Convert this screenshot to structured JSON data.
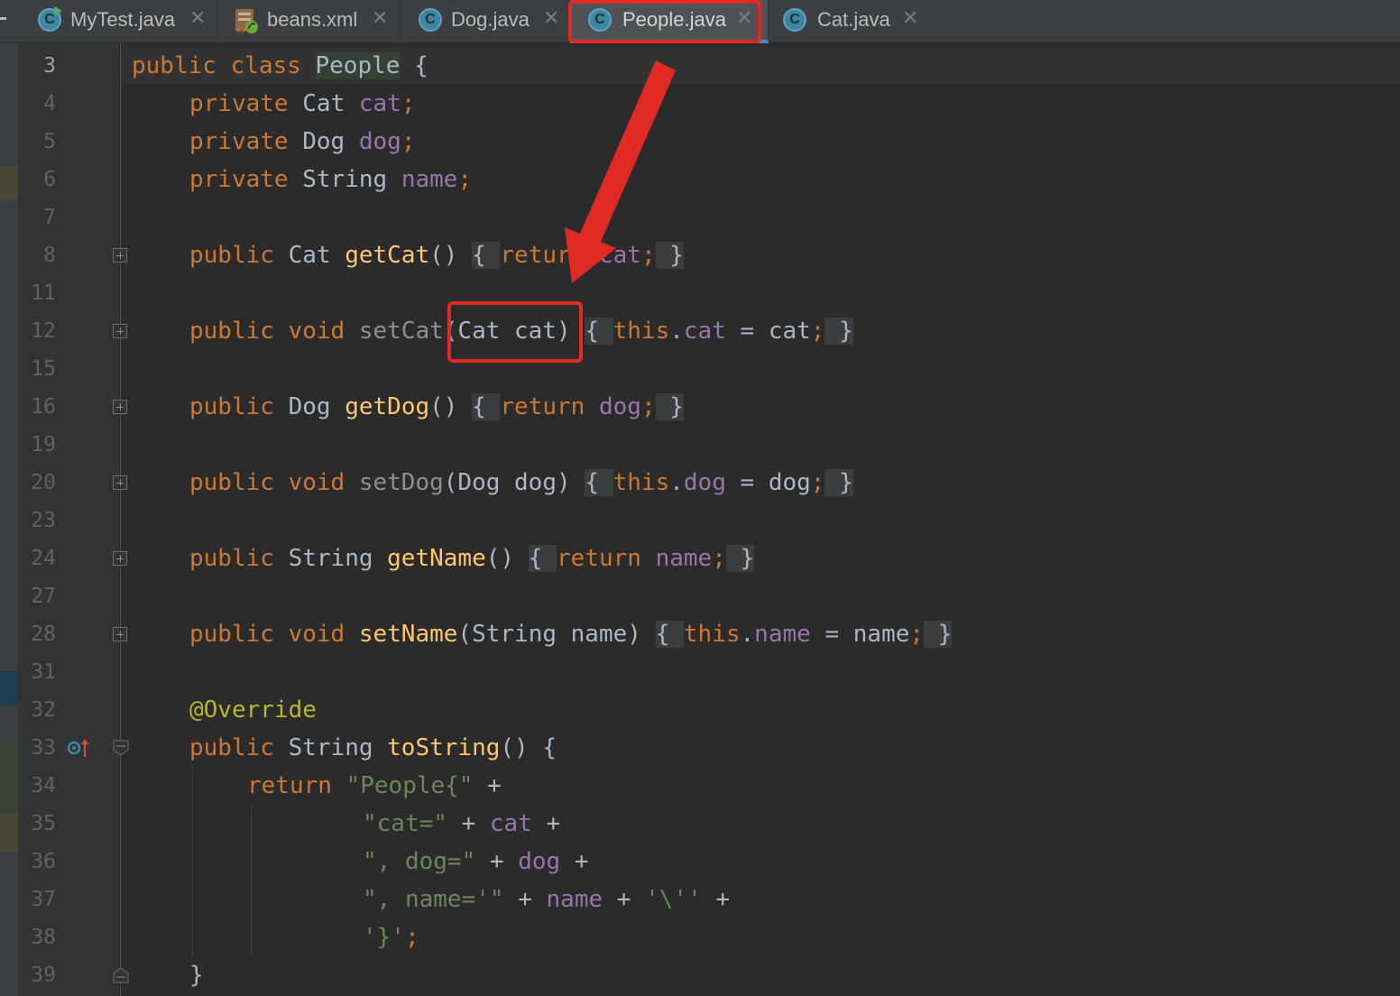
{
  "tabs": [
    {
      "label": "MyTest.java",
      "icon": "java-class-run-icon",
      "active": false
    },
    {
      "label": "beans.xml",
      "icon": "spring-xml-icon",
      "active": false
    },
    {
      "label": "Dog.java",
      "icon": "java-class-icon",
      "active": false
    },
    {
      "label": "People.java",
      "icon": "java-class-icon",
      "active": true
    },
    {
      "label": "Cat.java",
      "icon": "java-class-icon",
      "active": false
    }
  ],
  "tab_close_glyph": "✕",
  "class_icon_letter": "C",
  "line_numbers": [
    "3",
    "4",
    "5",
    "6",
    "7",
    "8",
    "11",
    "12",
    "15",
    "16",
    "19",
    "20",
    "23",
    "24",
    "27",
    "28",
    "31",
    "32",
    "33",
    "34",
    "35",
    "36",
    "37",
    "38",
    "39"
  ],
  "code": {
    "l3": {
      "kw": "public class ",
      "cls": "People",
      "rest": " {"
    },
    "l4": {
      "kw": "private ",
      "type": "Cat ",
      "field": "cat",
      "semi": ";"
    },
    "l5": {
      "kw": "private ",
      "type": "Dog ",
      "field": "dog",
      "semi": ";"
    },
    "l6": {
      "kw": "private ",
      "type": "String ",
      "field": "name",
      "semi": ";"
    },
    "l8": {
      "kw": "public ",
      "type": "Cat ",
      "fn": "getCat",
      "paren": "()",
      "sp": " ",
      "ob": "{ ",
      "ret": "return ",
      "field": "cat",
      "semi": ";",
      "sp2": " ",
      "cb": "}"
    },
    "l12": {
      "kw": "public void ",
      "fn": "setCat",
      "params": "(Cat cat)",
      "sp": " ",
      "ob": "{ ",
      "this": "this",
      "dot": ".",
      "field": "cat",
      "eq": " = cat",
      "semi": ";",
      "sp2": " ",
      "cb": "}"
    },
    "l16": {
      "kw": "public ",
      "type": "Dog ",
      "fn": "getDog",
      "paren": "()",
      "sp": " ",
      "ob": "{ ",
      "ret": "return ",
      "field": "dog",
      "semi": ";",
      "sp2": " ",
      "cb": "}"
    },
    "l20": {
      "kw": "public void ",
      "fn": "setDog",
      "params": "(Dog dog)",
      "sp": " ",
      "ob": "{ ",
      "this": "this",
      "dot": ".",
      "field": "dog",
      "eq": " = dog",
      "semi": ";",
      "sp2": " ",
      "cb": "}"
    },
    "l24": {
      "kw": "public ",
      "type": "String ",
      "fn": "getName",
      "paren": "()",
      "sp": " ",
      "ob": "{ ",
      "ret": "return ",
      "field": "name",
      "semi": ";",
      "sp2": " ",
      "cb": "}"
    },
    "l28": {
      "kw": "public void ",
      "fn": "setName",
      "params": "(String name)",
      "sp": " ",
      "ob": "{ ",
      "this": "this",
      "dot": ".",
      "field": "name",
      "eq": " = name",
      "semi": ";",
      "sp2": " ",
      "cb": "}"
    },
    "l32": {
      "ann": "@Override"
    },
    "l33": {
      "kw": "public ",
      "type": "String ",
      "fn": "toString",
      "rest": "() {"
    },
    "l34": {
      "ret": "return ",
      "str": "\"People{\"",
      "op": " +"
    },
    "l35": {
      "str": "\"cat=\"",
      "op": " + ",
      "field": "cat",
      "op2": " +"
    },
    "l36": {
      "str": "\", dog=\"",
      "op": " + ",
      "field": "dog",
      "op2": " +"
    },
    "l37": {
      "str": "\", name='\"",
      "op": " + ",
      "field": "name",
      "op2": " + ",
      "str2": "'\\''",
      "op3": " +"
    },
    "l38": {
      "str": "'}'",
      "semi": ";"
    },
    "l39": {
      "cb": "}"
    }
  },
  "colors": {
    "keyword": "#cc7832",
    "field": "#9876aa",
    "method": "#ffc66d",
    "string": "#6a8759",
    "annotation": "#bbb529",
    "text": "#a9b7c6",
    "annotation_red": "#e02a23"
  }
}
